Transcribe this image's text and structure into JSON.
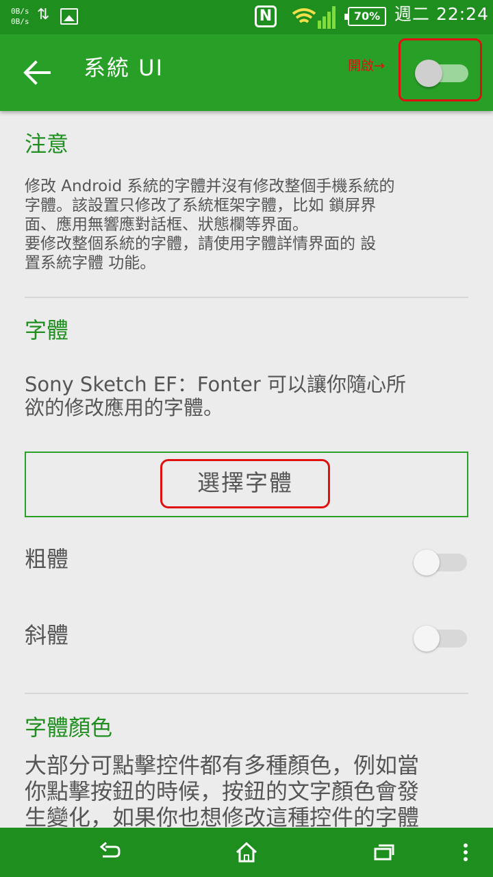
{
  "status_bar": {
    "net_speed_up": "0B/s",
    "net_speed_down": "0B/s",
    "arrows_icon": "up-down-arrows",
    "image_icon": "image-notification",
    "nfc_icon": "N",
    "signal_icon": "wifi-and-cellular",
    "battery": "70%",
    "time": "週二 22:24"
  },
  "app_bar": {
    "title": "系統 UI",
    "on_hint": "開啟→",
    "main_switch": {
      "on": false
    },
    "colors": {
      "primary": "#28a028",
      "status": "#1e8f1e",
      "highlight": "#e01010"
    }
  },
  "notice": {
    "title": "注意",
    "body_lines": [
      "修改 Android 系統的字體并沒有修改整個手機系統的",
      "字體。該設置只修改了系統框架字體，比如 鎖屏界",
      "面、應用無響應對話框、狀態欄等界面。",
      "要修改整個系統的字體，請使用字體詳情界面的 設",
      "置系統字體 功能。"
    ]
  },
  "font": {
    "title": "字體",
    "desc_line1": "Sony Sketch EF：Fonter 可以讓你隨心所",
    "desc_line2": "欲的修改應用的字體。",
    "select_button": "選擇字體",
    "bold_label": "粗體",
    "bold_on": false,
    "italic_label": "斜體",
    "italic_on": false
  },
  "font_color": {
    "title": "字體顏色",
    "body_lines": [
      "大部分可點擊控件都有多種顏色，例如當",
      "你點擊按鈕的時候，按鈕的文字顏色會發",
      "生變化，如果你也想修改這種控件的字體"
    ]
  },
  "nav_bar": {
    "back_icon": "back-icon",
    "home_icon": "home-icon",
    "recents_icon": "recents-icon",
    "menu_icon": "overflow-menu-icon"
  }
}
